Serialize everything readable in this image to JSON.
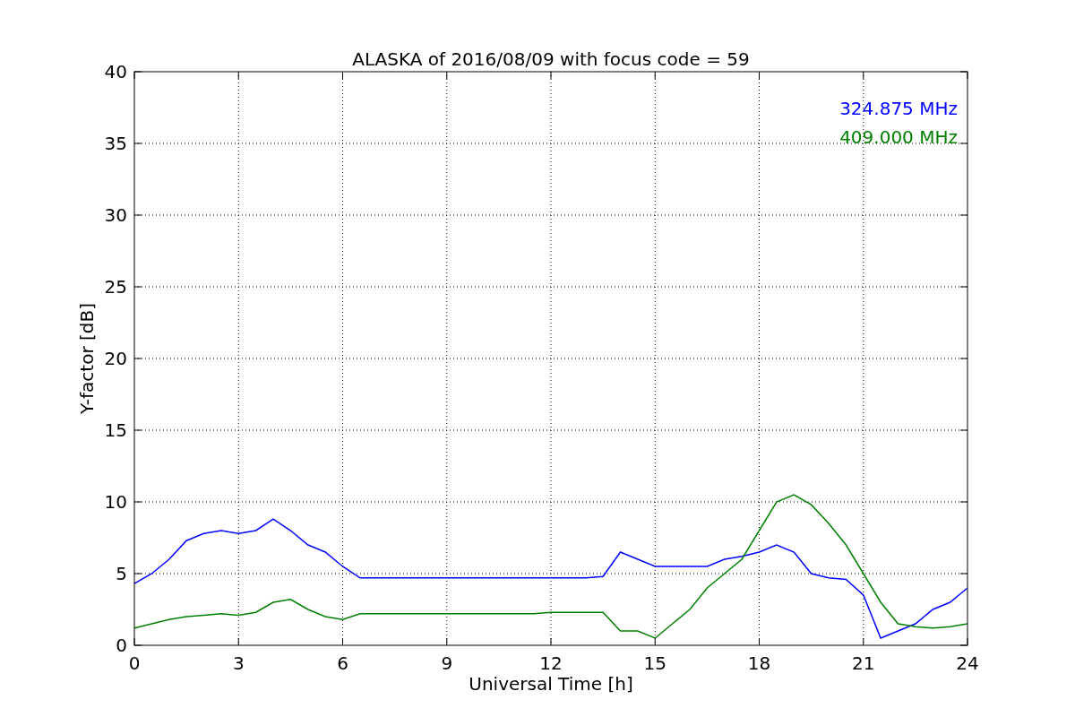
{
  "chart_data": {
    "type": "line",
    "title": "ALASKA of 2016/08/09 with focus code = 59",
    "xlabel": "Universal Time [h]",
    "ylabel": "Y-factor [dB]",
    "x": [
      0,
      0.5,
      1,
      1.5,
      2,
      2.5,
      3,
      3.5,
      4,
      4.5,
      5,
      5.5,
      6,
      6.5,
      7,
      7.5,
      8,
      8.5,
      9,
      9.5,
      10,
      10.5,
      11,
      11.5,
      12,
      12.5,
      13,
      13.5,
      14,
      14.5,
      15,
      15.5,
      16,
      16.5,
      17,
      17.5,
      18,
      18.5,
      19,
      19.5,
      20,
      20.5,
      21,
      21.5,
      22,
      22.5,
      23,
      23.5,
      24
    ],
    "series": [
      {
        "name": "324.875 MHz",
        "color": "#0000ff",
        "values": [
          4.3,
          5,
          6,
          7.3,
          7.8,
          8,
          7.8,
          8,
          8.8,
          8,
          7,
          6.5,
          5.5,
          4.7,
          4.7,
          4.7,
          4.7,
          4.7,
          4.7,
          4.7,
          4.7,
          4.7,
          4.7,
          4.7,
          4.7,
          4.7,
          4.7,
          4.8,
          6.5,
          6,
          5.5,
          5.5,
          5.5,
          5.5,
          6,
          6.2,
          6.5,
          7,
          6.5,
          5,
          4.7,
          4.6,
          3.5,
          0.5,
          1,
          1.5,
          2.5,
          3,
          4
        ]
      },
      {
        "name": "409.000 MHz",
        "color": "#008000",
        "values": [
          1.2,
          1.5,
          1.8,
          2,
          2.1,
          2.2,
          2.1,
          2.3,
          3,
          3.2,
          2.5,
          2,
          1.8,
          2.2,
          2.2,
          2.2,
          2.2,
          2.2,
          2.2,
          2.2,
          2.2,
          2.2,
          2.2,
          2.2,
          2.3,
          2.3,
          2.3,
          2.3,
          1,
          1,
          0.5,
          1.5,
          2.5,
          4,
          5,
          6,
          8,
          10,
          10.5,
          9.8,
          8.5,
          7,
          5,
          3,
          1.5,
          1.3,
          1.2,
          1.3,
          1.5
        ]
      }
    ],
    "xlim": [
      0,
      24
    ],
    "ylim": [
      0,
      40
    ],
    "xticks": [
      0,
      3,
      6,
      9,
      12,
      15,
      18,
      21,
      24
    ],
    "yticks": [
      0,
      5,
      10,
      15,
      20,
      25,
      30,
      35,
      40
    ],
    "grid": true
  }
}
